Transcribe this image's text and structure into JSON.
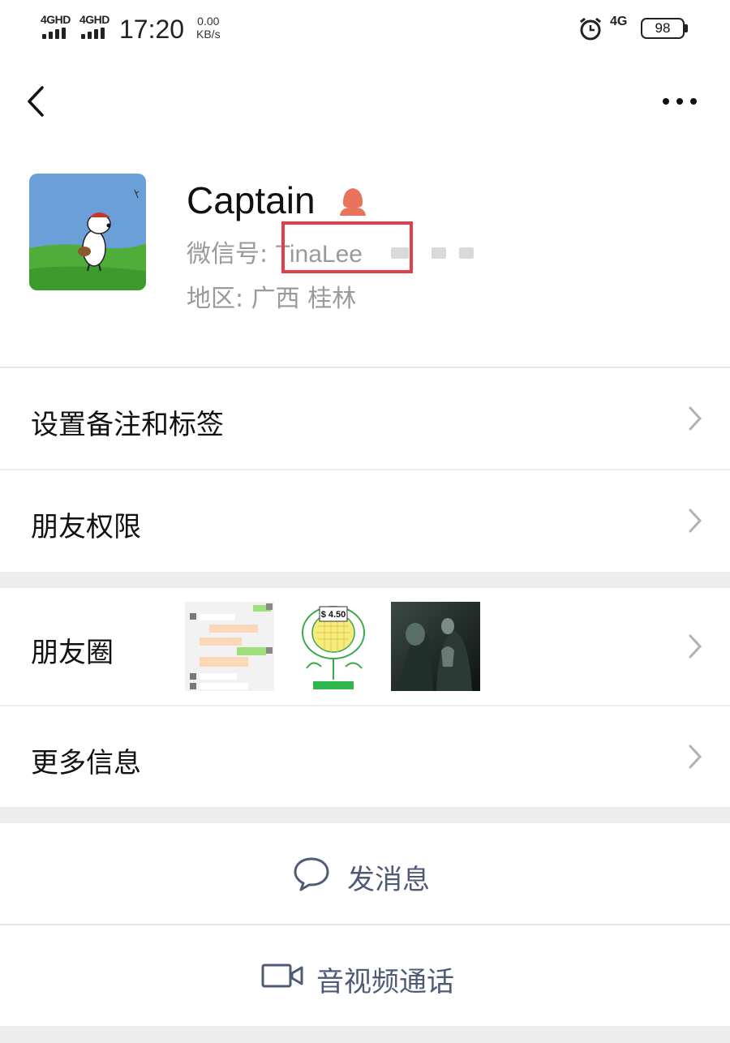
{
  "status_bar": {
    "sim1": "4GHD",
    "sim2": "4GHD",
    "time": "17:20",
    "speed_value": "0.00",
    "speed_unit": "KB/s",
    "network": "4G",
    "battery": "98",
    "icons": [
      "signal-icon",
      "alarm-icon",
      "battery-icon"
    ]
  },
  "navbar": {
    "back_icon": "chevron-left-icon",
    "more_icon": "more-dots-icon"
  },
  "profile": {
    "name": "Captain",
    "gender_icon": "female-user-icon",
    "wechat_id_label": "微信号: ",
    "wechat_id_value": "TinaLee",
    "region_label": "地区: ",
    "region_value": "广西  桂林",
    "highlight_color": "#e0404b"
  },
  "menu": {
    "remarks": "设置备注和标签",
    "permissions": "朋友权限",
    "moments": "朋友圈",
    "more_info": "更多信息"
  },
  "moments_thumbs": {
    "chat_screenshot": "chat-screenshot-thumbnail",
    "sunflower": "sunflower-drawing-thumbnail",
    "price_tag": "$ 4.50",
    "movie": "movie-still-thumbnail"
  },
  "actions": {
    "message": "发消息",
    "message_icon": "chat-bubble-icon",
    "call": "音视频通话",
    "call_icon": "video-camera-icon"
  },
  "colors": {
    "accent_text": "#4f5b76",
    "secondary_text": "#9a9a9a",
    "background": "#ededed"
  }
}
